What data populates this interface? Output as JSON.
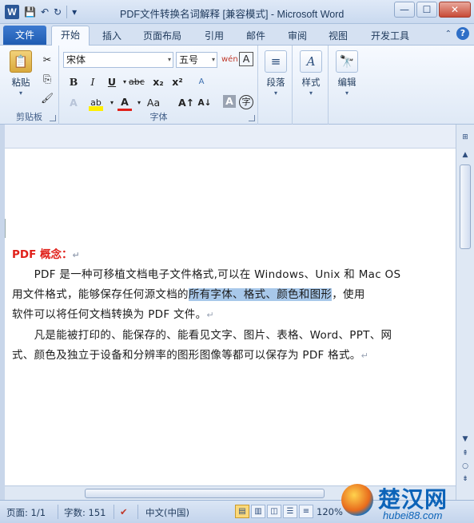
{
  "window": {
    "title": "PDF文件转换名词解释 [兼容模式] - Microsoft Word",
    "app_icon": "W",
    "minimize": "—",
    "maximize": "☐",
    "close": "✕"
  },
  "qat": {
    "save": "💾",
    "undo": "↶",
    "redo": "↻",
    "customize": "▾"
  },
  "tabs": {
    "file": "文件",
    "items": [
      "开始",
      "插入",
      "页面布局",
      "引用",
      "邮件",
      "审阅",
      "视图",
      "开发工具"
    ],
    "active": "开始"
  },
  "ribbon": {
    "clipboard": {
      "paste": "粘贴",
      "label": "剪贴板"
    },
    "font": {
      "label": "字体",
      "font_name": "宋体",
      "font_size": "五号",
      "bold": "B",
      "italic": "I",
      "underline": "U",
      "strike": "abc",
      "subscript": "x₂",
      "superscript": "x²",
      "grow": "A↑",
      "shrink": "A↓",
      "change_case": "Aa",
      "clear": "A",
      "highlight": "ab",
      "color": "A",
      "char_border": "A",
      "enclosed": "字",
      "phonetic": "wén",
      "char_shade": "A"
    },
    "paragraph": {
      "label": "段落"
    },
    "styles": {
      "label": "样式"
    },
    "editing": {
      "label": "编辑"
    }
  },
  "document": {
    "heading": "PDF 概念：",
    "lines": [
      {
        "pre": "　　PDF 是一种可移植文档电子文件格式,可以在 Windows、Unix 和 Mac OS",
        "hl": "",
        "post": ""
      },
      {
        "pre": "用文件格式，能够保存任何源文档的",
        "hl": "所有字体、格式、颜色和图形",
        "post": "，使用"
      },
      {
        "pre": "软件可以将任何文档转换为 PDF 文件。",
        "hl": "",
        "post": ""
      },
      {
        "pre": "　　凡是能被打印的、能保存的、能看见文字、图片、表格、Word、PPT、网",
        "hl": "",
        "post": ""
      },
      {
        "pre": "式、颜色及独立于设备和分辨率的图形图像等都可以保存为 PDF 格式。",
        "hl": "",
        "post": ""
      }
    ],
    "para_mark": "↵"
  },
  "status": {
    "page": "页面: 1/1",
    "words": "字数: 151",
    "language": "中文(中国)",
    "zoom": "120%"
  },
  "watermark": {
    "title": "楚汉网",
    "sub": "hubei88.com"
  }
}
